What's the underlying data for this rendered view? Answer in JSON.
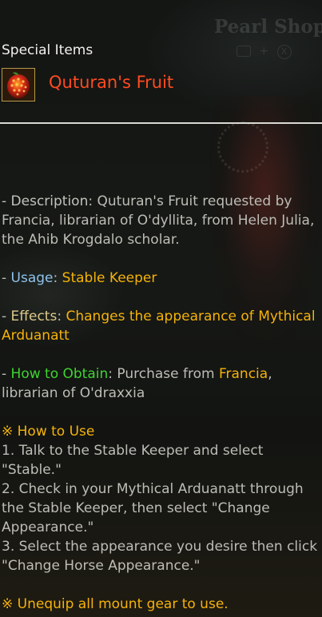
{
  "background": {
    "shop_title": "Pearl Shop",
    "key_hint_plus": "+",
    "key_hint_x": "X"
  },
  "tooltip": {
    "category": "Special Items",
    "item_name": "Quturan's Fruit",
    "item_icon": "red-fruit-icon",
    "description": {
      "label": "- Description",
      "sep": ": ",
      "text": "Quturan's Fruit requested by Francia, librarian of O'dyllita, from Helen Julia, the Ahib Krogdalo scholar."
    },
    "usage": {
      "prefix": "- ",
      "label": "Usage",
      "sep": ": ",
      "value": "Stable Keeper"
    },
    "effects": {
      "prefix": "- ",
      "label": "Effects",
      "sep": ": ",
      "value": "Changes the appearance of Mythical Arduanatt"
    },
    "obtain": {
      "prefix": "- ",
      "label": "How to Obtain",
      "sep": ": ",
      "text_before": "Purchase from ",
      "npc": "Francia",
      "text_after": ", librarian of O'draxxia"
    },
    "how_to_use": {
      "title": "※ How to Use",
      "steps": [
        " 1. Talk to the Stable Keeper and select \"Stable.\"",
        " 2. Check in your Mythical Arduanatt through the Stable Keeper, then select \"Change Appearance.\"",
        " 3. Select the appearance you desire then click \"Change Horse Appearance.\""
      ]
    },
    "warning": "※ Unequip all mount gear to use."
  },
  "colors": {
    "item_name": "#ff4b20",
    "highlight": "#f5b20a",
    "usage_label": "#8ec2ec",
    "obtain_label": "#3ed430",
    "body_text": "#bdbdb6"
  }
}
